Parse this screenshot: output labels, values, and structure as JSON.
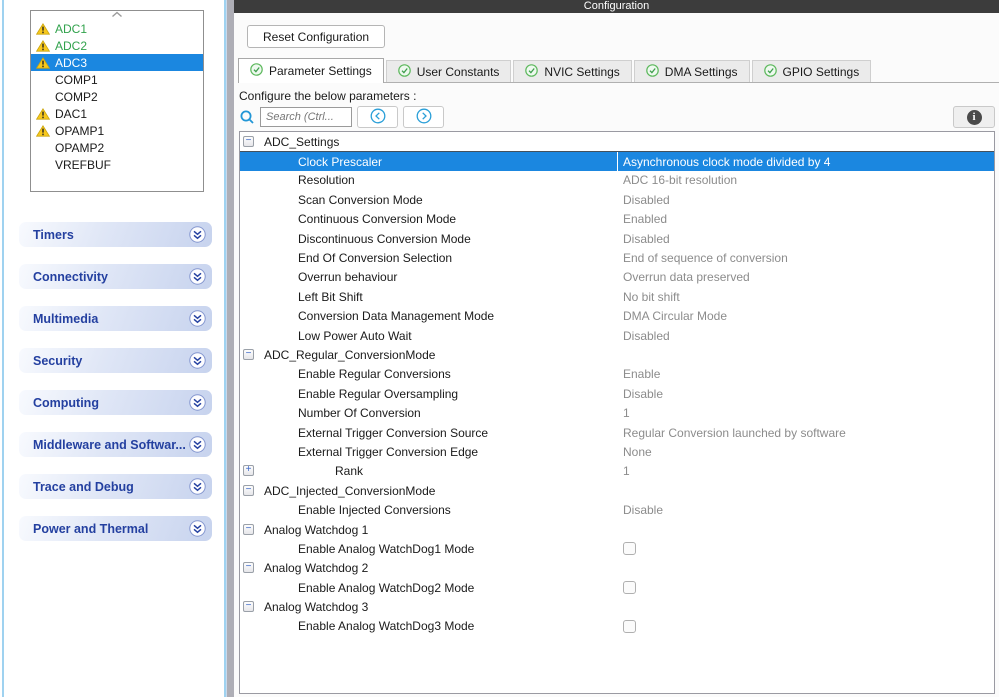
{
  "colors": {
    "selection_blue": "#1b87e0",
    "warning_yellow": "#f8c81c",
    "green_check": "#5cb85c",
    "device_green": "#31a24c",
    "category_text": "#2440a0",
    "header_bar": "#3c3c3c",
    "value_gray": "#8c8c8c",
    "search_icon_blue": "#2196d6"
  },
  "icons": {
    "scroll_up": "chevron-up",
    "warning": "yellow-warning-triangle",
    "category_chevron": "double-chevron-down-circle",
    "tab_check": "green-check-circle",
    "search": "magnifier",
    "search_prev": "circle-chevron-left",
    "search_next": "circle-chevron-right",
    "info": "info-circle",
    "expand_collapse": "plus-minus-box"
  },
  "left_panel": {
    "device_list": {
      "items": [
        {
          "label": "ADC1",
          "warning": true,
          "green": true
        },
        {
          "label": "ADC2",
          "warning": true,
          "green": true
        },
        {
          "label": "ADC3",
          "warning": true,
          "selected": true
        },
        {
          "label": "COMP1"
        },
        {
          "label": "COMP2"
        },
        {
          "label": "DAC1",
          "warning": true
        },
        {
          "label": "OPAMP1",
          "warning": true
        },
        {
          "label": "OPAMP2"
        },
        {
          "label": "VREFBUF"
        }
      ]
    },
    "categories": [
      "Timers",
      "Connectivity",
      "Multimedia",
      "Security",
      "Computing",
      "Middleware and Softwar...",
      "Trace and Debug",
      "Power and Thermal"
    ]
  },
  "header": {
    "title": "Configuration"
  },
  "toolbar": {
    "reset_label": "Reset Configuration"
  },
  "tabs": [
    {
      "label": "Parameter Settings",
      "active": true
    },
    {
      "label": "User Constants"
    },
    {
      "label": "NVIC Settings"
    },
    {
      "label": "DMA Settings"
    },
    {
      "label": "GPIO Settings"
    }
  ],
  "params": {
    "caption": "Configure the below parameters :",
    "search_placeholder": "Search (Ctrl..."
  },
  "tree": {
    "rows": [
      {
        "type": "group",
        "name": "ADC_Settings",
        "expander": "minus",
        "indent": "group",
        "value": ""
      },
      {
        "type": "param",
        "name": "Clock Prescaler",
        "indent": "param",
        "value": "Asynchronous clock mode divided by 4",
        "selected": true
      },
      {
        "type": "param",
        "name": "Resolution",
        "indent": "param",
        "value": "ADC 16-bit resolution"
      },
      {
        "type": "param",
        "name": "Scan Conversion Mode",
        "indent": "param",
        "value": "Disabled"
      },
      {
        "type": "param",
        "name": "Continuous Conversion Mode",
        "indent": "param",
        "value": "Enabled"
      },
      {
        "type": "param",
        "name": "Discontinuous Conversion Mode",
        "indent": "param",
        "value": "Disabled"
      },
      {
        "type": "param",
        "name": "End Of Conversion Selection",
        "indent": "param",
        "value": "End of sequence of conversion"
      },
      {
        "type": "param",
        "name": "Overrun behaviour",
        "indent": "param",
        "value": "Overrun data preserved"
      },
      {
        "type": "param",
        "name": "Left Bit Shift",
        "indent": "param",
        "value": "No bit shift"
      },
      {
        "type": "param",
        "name": "Conversion Data Management Mode",
        "indent": "param",
        "value": "DMA Circular Mode"
      },
      {
        "type": "param",
        "name": "Low Power Auto Wait",
        "indent": "param",
        "value": "Disabled"
      },
      {
        "type": "group",
        "name": "ADC_Regular_ConversionMode",
        "expander": "minus",
        "indent": "group",
        "value": ""
      },
      {
        "type": "param",
        "name": "Enable Regular Conversions",
        "indent": "param",
        "value": "Enable"
      },
      {
        "type": "param",
        "name": "Enable Regular Oversampling",
        "indent": "param",
        "value": "Disable"
      },
      {
        "type": "param",
        "name": "Number Of Conversion",
        "indent": "param",
        "value": "1"
      },
      {
        "type": "param",
        "name": "External Trigger Conversion Source",
        "indent": "param",
        "value": "Regular Conversion launched by software"
      },
      {
        "type": "param",
        "name": "External Trigger Conversion Edge",
        "indent": "param",
        "value": "None"
      },
      {
        "type": "param",
        "name": "Rank",
        "expander": "plus",
        "indent": "rank",
        "value": "1"
      },
      {
        "type": "group",
        "name": "ADC_Injected_ConversionMode",
        "expander": "minus",
        "indent": "group",
        "value": ""
      },
      {
        "type": "param",
        "name": "Enable Injected Conversions",
        "indent": "param",
        "value": "Disable"
      },
      {
        "type": "group",
        "name": "Analog Watchdog 1",
        "expander": "minus",
        "indent": "group",
        "value": ""
      },
      {
        "type": "param",
        "name": "Enable Analog WatchDog1 Mode",
        "indent": "param",
        "value": "",
        "checkbox": true,
        "checked": false
      },
      {
        "type": "group",
        "name": "Analog Watchdog 2",
        "expander": "minus",
        "indent": "group",
        "value": ""
      },
      {
        "type": "param",
        "name": "Enable Analog WatchDog2 Mode",
        "indent": "param",
        "value": "",
        "checkbox": true,
        "checked": false
      },
      {
        "type": "group",
        "name": "Analog Watchdog 3",
        "expander": "minus",
        "indent": "group",
        "value": ""
      },
      {
        "type": "param",
        "name": "Enable Analog WatchDog3 Mode",
        "indent": "param",
        "value": "",
        "checkbox": true,
        "checked": false
      }
    ]
  }
}
